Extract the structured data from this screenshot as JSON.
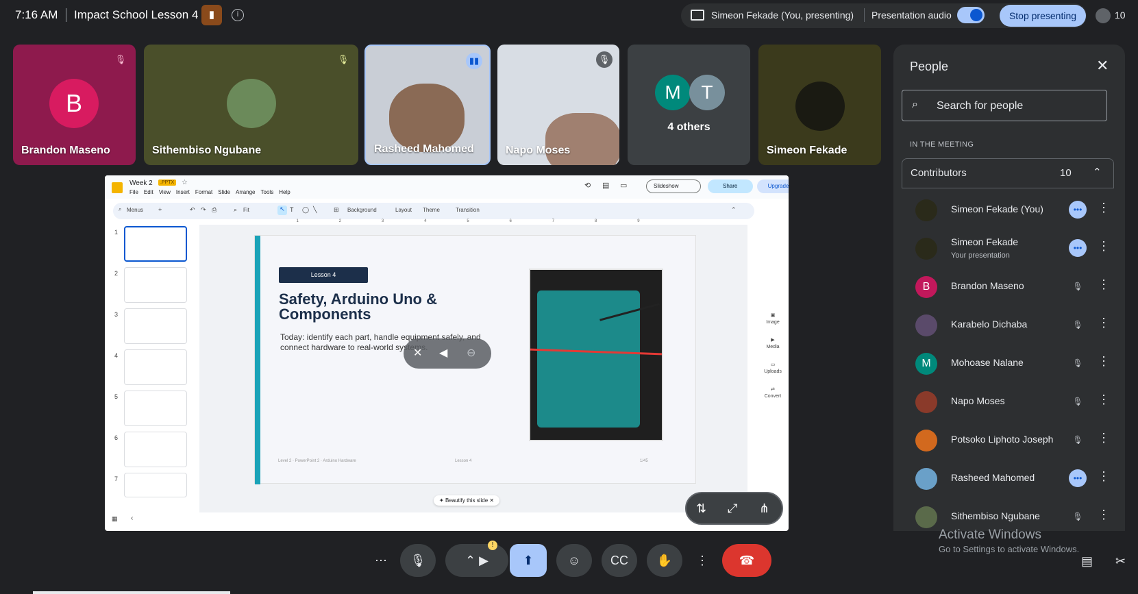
{
  "topbar": {
    "time": "7:16 AM",
    "meeting_title": "Impact School Lesson 4",
    "presenting_label": "Simeon Fekade (You, presenting)",
    "audio_label": "Presentation audio",
    "stop_label": "Stop presenting",
    "participant_count": "10"
  },
  "tiles": [
    {
      "name": "Brandon Maseno",
      "initial": "B",
      "color": "#c2185b",
      "bg": "#8e1a4d"
    },
    {
      "name": "Sithembiso Ngubane",
      "bg": "#4a4f2a"
    },
    {
      "name": "Rasheed Mahomed",
      "bg": "#c9ced6"
    },
    {
      "name": "Napo Moses",
      "bg": "#d8dde4"
    },
    {
      "name": "4 others",
      "initials": [
        "M",
        "T"
      ],
      "bg": "#3c4043"
    },
    {
      "name": "Simeon Fekade",
      "bg": "#3b3a1c"
    }
  ],
  "slides": {
    "doc_title": "Week 2",
    "doc_badge": ".PPTX",
    "menu": [
      "File",
      "Edit",
      "View",
      "Insert",
      "Format",
      "Slide",
      "Arrange",
      "Tools",
      "Help"
    ],
    "toolbar": {
      "menus": "Menus",
      "zoom": "Fit",
      "background": "Background",
      "layout": "Layout",
      "theme": "Theme",
      "transition": "Transition"
    },
    "slideshow_label": "Slideshow",
    "share_label": "Share",
    "upgrade_label": "Upgrade",
    "slide_numbers": [
      "1",
      "2",
      "3",
      "4",
      "5",
      "6",
      "7"
    ],
    "ruler": [
      "1",
      "2",
      "3",
      "4",
      "5",
      "6",
      "7",
      "8",
      "9"
    ],
    "current_slide": {
      "badge": "Lesson 4",
      "title": "Safety, Arduino Uno & Components",
      "body": "Today: identify each part, handle equipment safely, and connect hardware to real-world systems.",
      "footer_left": "Level 2 · PowerPoint 2 · Arduino Hardware",
      "footer_center": "Lesson 4",
      "footer_right": "1/45"
    },
    "side_tools": [
      "Image",
      "Media",
      "Uploads",
      "Convert"
    ],
    "beautify_label": "Beautify this slide"
  },
  "people": {
    "title": "People",
    "search_placeholder": "Search for people",
    "section": "IN THE MEETING",
    "group_label": "Contributors",
    "group_count": "10",
    "list": [
      {
        "name": "Simeon Fekade (You)",
        "sub": "",
        "status": "speaking",
        "color": "#2a2a1a"
      },
      {
        "name": "Simeon Fekade",
        "sub": "Your presentation",
        "status": "speaking",
        "color": "#2a2a1a"
      },
      {
        "name": "Brandon Maseno",
        "sub": "",
        "status": "muted",
        "initial": "B",
        "color": "#c2185b"
      },
      {
        "name": "Karabelo Dichaba",
        "sub": "",
        "status": "muted",
        "color": "#5a4a6a"
      },
      {
        "name": "Mohoase Nalane",
        "sub": "",
        "status": "muted",
        "initial": "M",
        "color": "#00897b"
      },
      {
        "name": "Napo Moses",
        "sub": "",
        "status": "muted",
        "color": "#8a3a2a"
      },
      {
        "name": "Potsoko Liphoto Joseph",
        "sub": "",
        "status": "muted",
        "color": "#d2691e"
      },
      {
        "name": "Rasheed Mahomed",
        "sub": "",
        "status": "speaking",
        "color": "#6aa0c8"
      },
      {
        "name": "Sithembiso Ngubane",
        "sub": "",
        "status": "muted",
        "color": "#5a6a4a"
      }
    ]
  },
  "windows_watermark": {
    "line1": "Activate Windows",
    "line2": "Go to Settings to activate Windows."
  }
}
